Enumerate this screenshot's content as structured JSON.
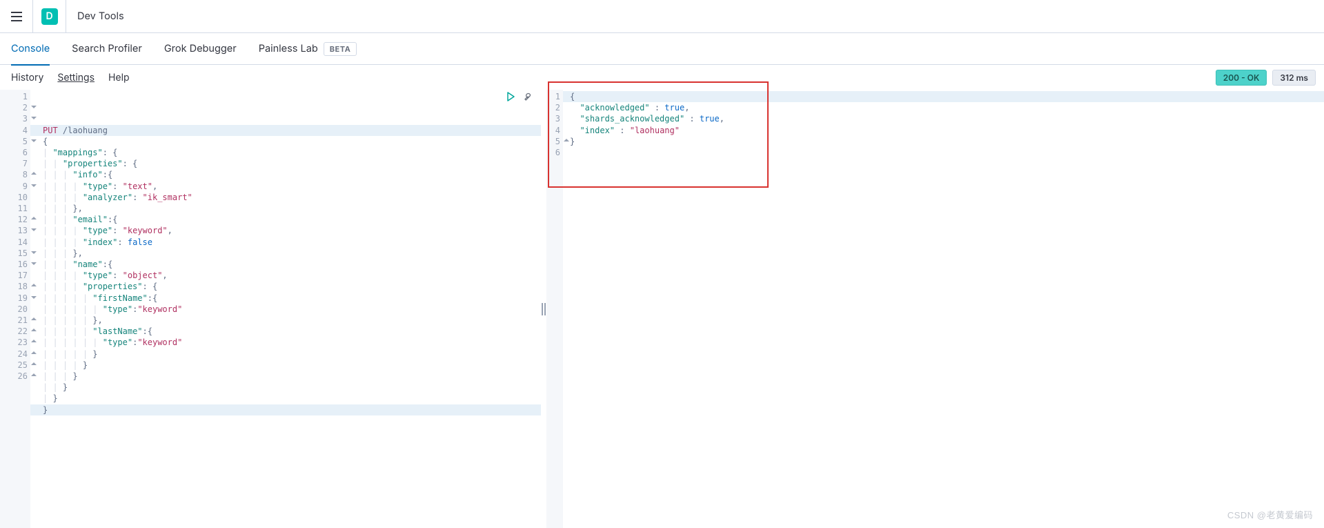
{
  "header": {
    "badge_letter": "D",
    "breadcrumb": "Dev Tools"
  },
  "tabs": [
    {
      "label": "Console",
      "active": true
    },
    {
      "label": "Search Profiler"
    },
    {
      "label": "Grok Debugger"
    },
    {
      "label": "Painless Lab",
      "beta": "BETA"
    }
  ],
  "subbar": {
    "links": [
      "History",
      "Settings",
      "Help"
    ],
    "status_badge": "200 - OK",
    "time_badge": "312 ms"
  },
  "request": {
    "method": "PUT",
    "path": "/laohuang",
    "lines": [
      {
        "n": 1,
        "hl": true
      },
      {
        "n": 2,
        "fold": "open",
        "text": "{"
      },
      {
        "n": 3,
        "fold": "open",
        "indent": 1,
        "key": "\"mappings\"",
        "after": ": {"
      },
      {
        "n": 4,
        "fold": "open",
        "indent": 2,
        "key": "\"properties\"",
        "after": ": {"
      },
      {
        "n": 5,
        "fold": "open",
        "indent": 3,
        "key": "\"info\"",
        "after": ":{"
      },
      {
        "n": 6,
        "indent": 4,
        "key": "\"type\"",
        "after": ": ",
        "val": "\"text\"",
        "tail": ","
      },
      {
        "n": 7,
        "indent": 4,
        "key": "\"analyzer\"",
        "after": ": ",
        "val": "\"ik_smart\""
      },
      {
        "n": 8,
        "fold": "up",
        "indent": 3,
        "text": "},"
      },
      {
        "n": 9,
        "fold": "open",
        "indent": 3,
        "key": "\"email\"",
        "after": ":{"
      },
      {
        "n": 10,
        "indent": 4,
        "key": "\"type\"",
        "after": ": ",
        "val": "\"keyword\"",
        "tail": ","
      },
      {
        "n": 11,
        "indent": 4,
        "key": "\"index\"",
        "after": ": ",
        "kw": "false"
      },
      {
        "n": 12,
        "fold": "up",
        "indent": 3,
        "text": "},"
      },
      {
        "n": 13,
        "fold": "open",
        "indent": 3,
        "key": "\"name\"",
        "after": ":{"
      },
      {
        "n": 14,
        "indent": 4,
        "key": "\"type\"",
        "after": ": ",
        "val": "\"object\"",
        "tail": ","
      },
      {
        "n": 15,
        "fold": "open",
        "indent": 4,
        "key": "\"properties\"",
        "after": ": {"
      },
      {
        "n": 16,
        "fold": "open",
        "indent": 5,
        "key": "\"firstName\"",
        "after": ":{"
      },
      {
        "n": 17,
        "indent": 6,
        "key": "\"type\"",
        "after": ":",
        "val": "\"keyword\""
      },
      {
        "n": 18,
        "fold": "up",
        "indent": 5,
        "text": "},"
      },
      {
        "n": 19,
        "fold": "open",
        "indent": 5,
        "key": "\"lastName\"",
        "after": ":{"
      },
      {
        "n": 20,
        "indent": 6,
        "key": "\"type\"",
        "after": ":",
        "val": "\"keyword\""
      },
      {
        "n": 21,
        "fold": "up",
        "indent": 5,
        "text": "}"
      },
      {
        "n": 22,
        "fold": "up",
        "indent": 4,
        "text": "}"
      },
      {
        "n": 23,
        "fold": "up",
        "indent": 3,
        "text": "}"
      },
      {
        "n": 24,
        "fold": "up",
        "indent": 2,
        "text": "}"
      },
      {
        "n": 25,
        "fold": "up",
        "indent": 1,
        "text": "}"
      },
      {
        "n": 26,
        "fold": "up",
        "hl": true,
        "text": "}"
      }
    ]
  },
  "response": {
    "lines": [
      {
        "n": 1,
        "fold": "open",
        "hl": true,
        "text": "{"
      },
      {
        "n": 2,
        "indent": 1,
        "key": "\"acknowledged\"",
        "after": " : ",
        "kw": "true",
        "tail": ","
      },
      {
        "n": 3,
        "indent": 1,
        "key": "\"shards_acknowledged\"",
        "after": " : ",
        "kw": "true",
        "tail": ","
      },
      {
        "n": 4,
        "indent": 1,
        "key": "\"index\"",
        "after": " : ",
        "val": "\"laohuang\""
      },
      {
        "n": 5,
        "fold": "up",
        "text": "}"
      },
      {
        "n": 6,
        "text": ""
      }
    ]
  },
  "watermark": "CSDN @老黄爱编码"
}
